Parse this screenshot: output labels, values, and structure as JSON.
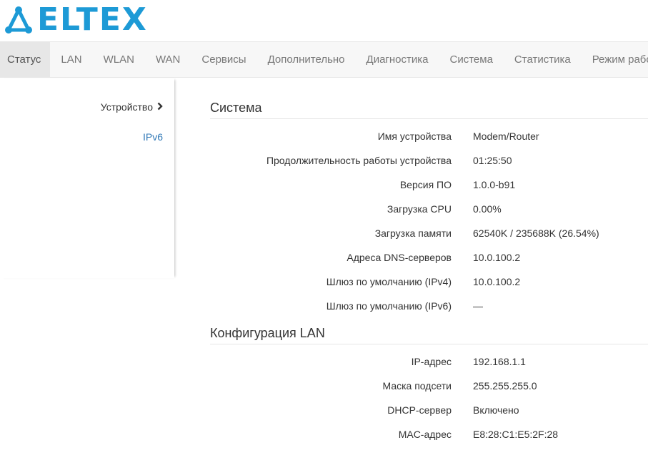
{
  "brand": {
    "logo_text": "ELTEX",
    "logo_color": "#1d9ad6"
  },
  "nav": {
    "items": [
      {
        "label": "Статус",
        "active": true
      },
      {
        "label": "LAN"
      },
      {
        "label": "WLAN"
      },
      {
        "label": "WAN"
      },
      {
        "label": "Сервисы"
      },
      {
        "label": "Дополнительно"
      },
      {
        "label": "Диагностика"
      },
      {
        "label": "Система"
      },
      {
        "label": "Статистика"
      },
      {
        "label": "Режим работы"
      }
    ]
  },
  "sidebar": {
    "items": [
      {
        "label": "Устройство",
        "icon": "chevron-right-icon",
        "active": true
      },
      {
        "label": "IPv6"
      }
    ]
  },
  "system": {
    "title": "Система",
    "rows": [
      {
        "label": "Имя устройства",
        "value": "Modem/Router"
      },
      {
        "label": "Продолжительность работы устройства",
        "value": "01:25:50"
      },
      {
        "label": "Версия ПО",
        "value": "1.0.0-b91"
      },
      {
        "label": "Загрузка CPU",
        "value": "0.00%"
      },
      {
        "label": "Загрузка памяти",
        "value": "62540K / 235688K (26.54%)"
      },
      {
        "label": "Адреса DNS-серверов",
        "value": "10.0.100.2"
      },
      {
        "label": "Шлюз по умолчанию (IPv4)",
        "value": "10.0.100.2"
      },
      {
        "label": "Шлюз по умолчанию (IPv6)",
        "value": "—"
      }
    ]
  },
  "lan": {
    "title": "Конфигурация LAN",
    "rows": [
      {
        "label": "IP-адрес",
        "value": "192.168.1.1"
      },
      {
        "label": "Маска подсети",
        "value": "255.255.255.0"
      },
      {
        "label": "DHCP-сервер",
        "value": "Включено"
      },
      {
        "label": "MAC-адрес",
        "value": "E8:28:C1:E5:2F:28"
      }
    ]
  }
}
